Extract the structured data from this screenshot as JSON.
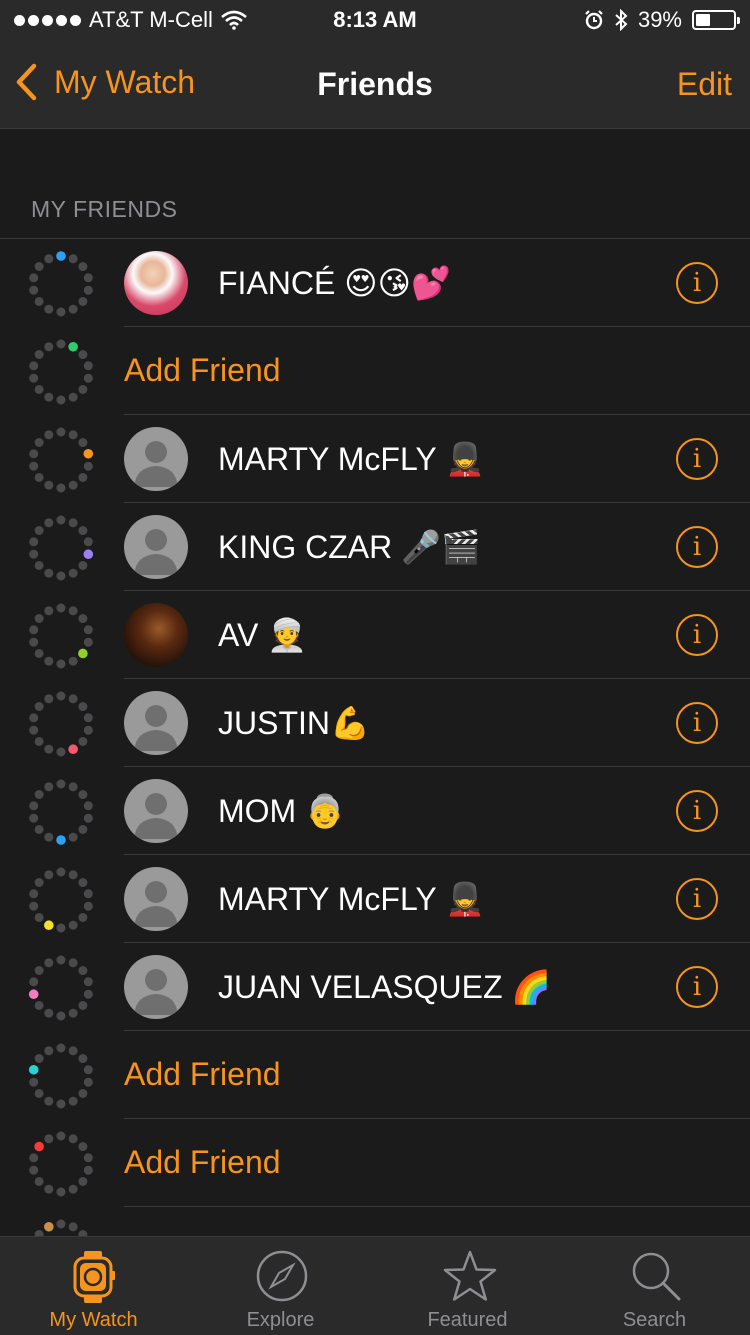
{
  "status_bar": {
    "carrier": "AT&T M-Cell",
    "time": "8:13 AM",
    "battery": "39%",
    "battery_level": 0.39,
    "icons": [
      "signal-dots",
      "wifi-icon",
      "alarm-icon",
      "bluetooth-icon",
      "battery-icon"
    ]
  },
  "nav": {
    "back_label": "My Watch",
    "title": "Friends",
    "edit_label": "Edit"
  },
  "section": {
    "title": "MY FRIENDS"
  },
  "accent_color": "#f7941d",
  "rows": [
    {
      "type": "friend",
      "name": "FIANCÉ 😍😘💕",
      "avatar": "photo",
      "ring_color": "#2aa3f5"
    },
    {
      "type": "add",
      "label": "Add Friend",
      "ring_color": "#2ecc71"
    },
    {
      "type": "friend",
      "name": "MARTY McFLY 💂",
      "avatar": "default",
      "ring_color": "#f7941d"
    },
    {
      "type": "friend",
      "name": "KING CZAR 🎤🎬",
      "avatar": "default",
      "ring_color": "#9b7ff5"
    },
    {
      "type": "friend",
      "name": "AV 👳",
      "avatar": "photo-dark",
      "ring_color": "#8fd12a"
    },
    {
      "type": "friend",
      "name": "JUSTIN💪",
      "avatar": "default",
      "ring_color": "#f55a6a"
    },
    {
      "type": "friend",
      "name": "MOM 👵",
      "avatar": "default",
      "ring_color": "#2aa3f5"
    },
    {
      "type": "friend",
      "name": "MARTY McFLY 💂",
      "avatar": "default",
      "ring_color": "#f5e02a"
    },
    {
      "type": "friend",
      "name": "JUAN VELASQUEZ 🌈",
      "avatar": "default",
      "ring_color": "#f57ac0"
    },
    {
      "type": "add",
      "label": "Add Friend",
      "ring_color": "#2ad1d1"
    },
    {
      "type": "add",
      "label": "Add Friend",
      "ring_color": "#f53a3a"
    },
    {
      "type": "partial",
      "ring_color": "#c8914a"
    }
  ],
  "tabs": [
    {
      "label": "My Watch",
      "icon": "watch-icon",
      "active": true
    },
    {
      "label": "Explore",
      "icon": "compass-icon",
      "active": false
    },
    {
      "label": "Featured",
      "icon": "star-icon",
      "active": false
    },
    {
      "label": "Search",
      "icon": "search-icon",
      "active": false
    }
  ]
}
